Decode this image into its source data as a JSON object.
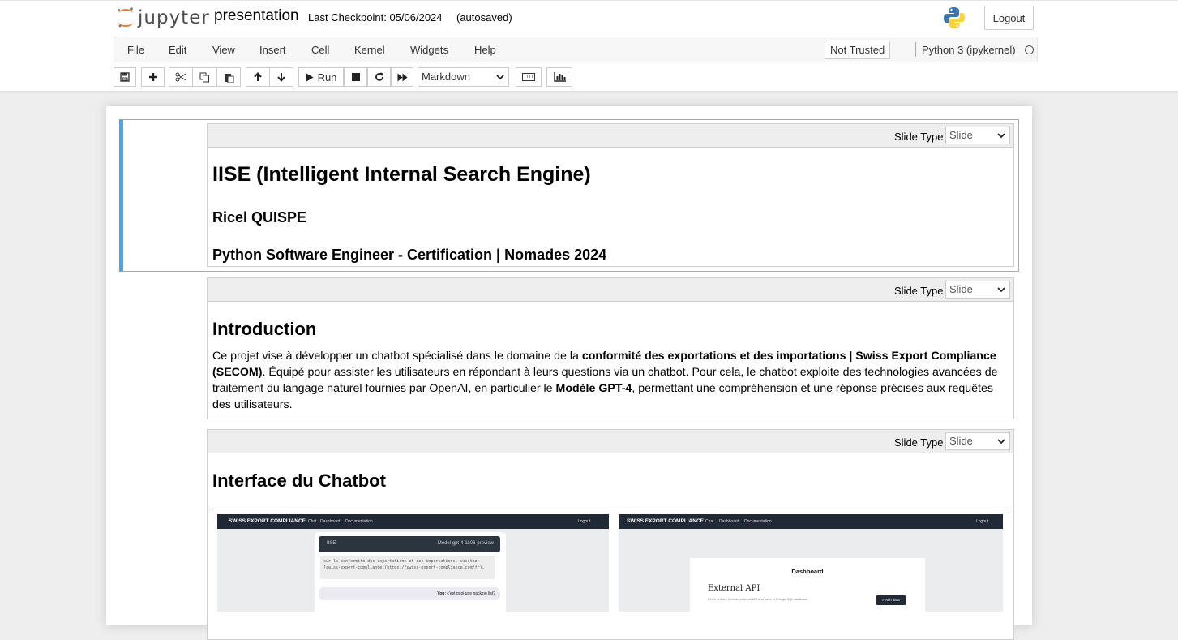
{
  "header": {
    "logo_text": "jupyter",
    "notebook_name": "presentation",
    "checkpoint_text": "Last Checkpoint: 05/06/2024",
    "autosave_status": "(autosaved)",
    "logout_label": "Logout"
  },
  "menubar": {
    "items": [
      "File",
      "Edit",
      "View",
      "Insert",
      "Cell",
      "Kernel",
      "Widgets",
      "Help"
    ],
    "trust_status": "Not Trusted",
    "kernel_name": "Python 3 (ipykernel)"
  },
  "toolbar": {
    "run_label": "Run",
    "cell_type": "Markdown",
    "buttons": [
      "save-icon",
      "plus-icon",
      "cut-icon",
      "copy-icon",
      "paste-icon",
      "arrow-up-icon",
      "arrow-down-icon",
      "run-icon",
      "stop-icon",
      "restart-icon",
      "fast-forward-icon",
      "keyboard-icon",
      "chart-icon"
    ]
  },
  "cells": [
    {
      "slide_type_label": "Slide Type",
      "slide_type": "Slide",
      "title": "IISE (Intelligent Internal Search Engine)",
      "author": "Ricel QUISPE",
      "subtitle": "Python Software Engineer - Certification | Nomades 2024"
    },
    {
      "slide_type_label": "Slide Type",
      "slide_type": "Slide",
      "heading": "Introduction",
      "text_1": "Ce projet vise à développer un chatbot spécialisé dans le domaine de la ",
      "bold_1": "conformité des exportations et des importations | Swiss Export Compliance (SECOM)",
      "text_2": ". Équipé pour assister les utilisateurs en répondant à leurs questions via un chatbot. Pour cela, le chatbot exploite des technologies avancées de traitement du langage naturel fournies par OpenAI, en particulier le ",
      "bold_2": "Modèle GPT-4",
      "text_3": ", permettant une compréhension et une réponse précises aux requêtes des utilisateurs."
    },
    {
      "slide_type_label": "Slide Type",
      "slide_type": "Slide",
      "heading": "Interface du Chatbot",
      "screenshots": [
        {
          "brand": "SWISS EXPORT COMPLIANCE",
          "links": [
            "Chat",
            "Dashboard",
            "Documentation"
          ],
          "logout": "Logout",
          "chat_title": "IISE",
          "model": "Model gpt-4-1106-preview",
          "chat_text": "sur la conformité des exportations et des importations, visitez [swiss-export-compliance](https://swiss-export-compliance.com/fr).",
          "you_label": "You:",
          "you_text": "c'est quoi une packing list?"
        },
        {
          "brand": "SWISS EXPORT COMPLIANCE",
          "links": [
            "Chat",
            "Dashboard",
            "Documentation"
          ],
          "logout": "Logout",
          "panel_title": "Dashboard",
          "section_title": "External API",
          "section_text": "Fetch articles from an external API and save in PostgreSQL database.",
          "fetch_label": "Fetch data"
        }
      ]
    }
  ],
  "colors": {
    "selected_cell_border": "#42a5f5",
    "jupyter_orange": "#f37726",
    "nav_dark": "#212936"
  }
}
